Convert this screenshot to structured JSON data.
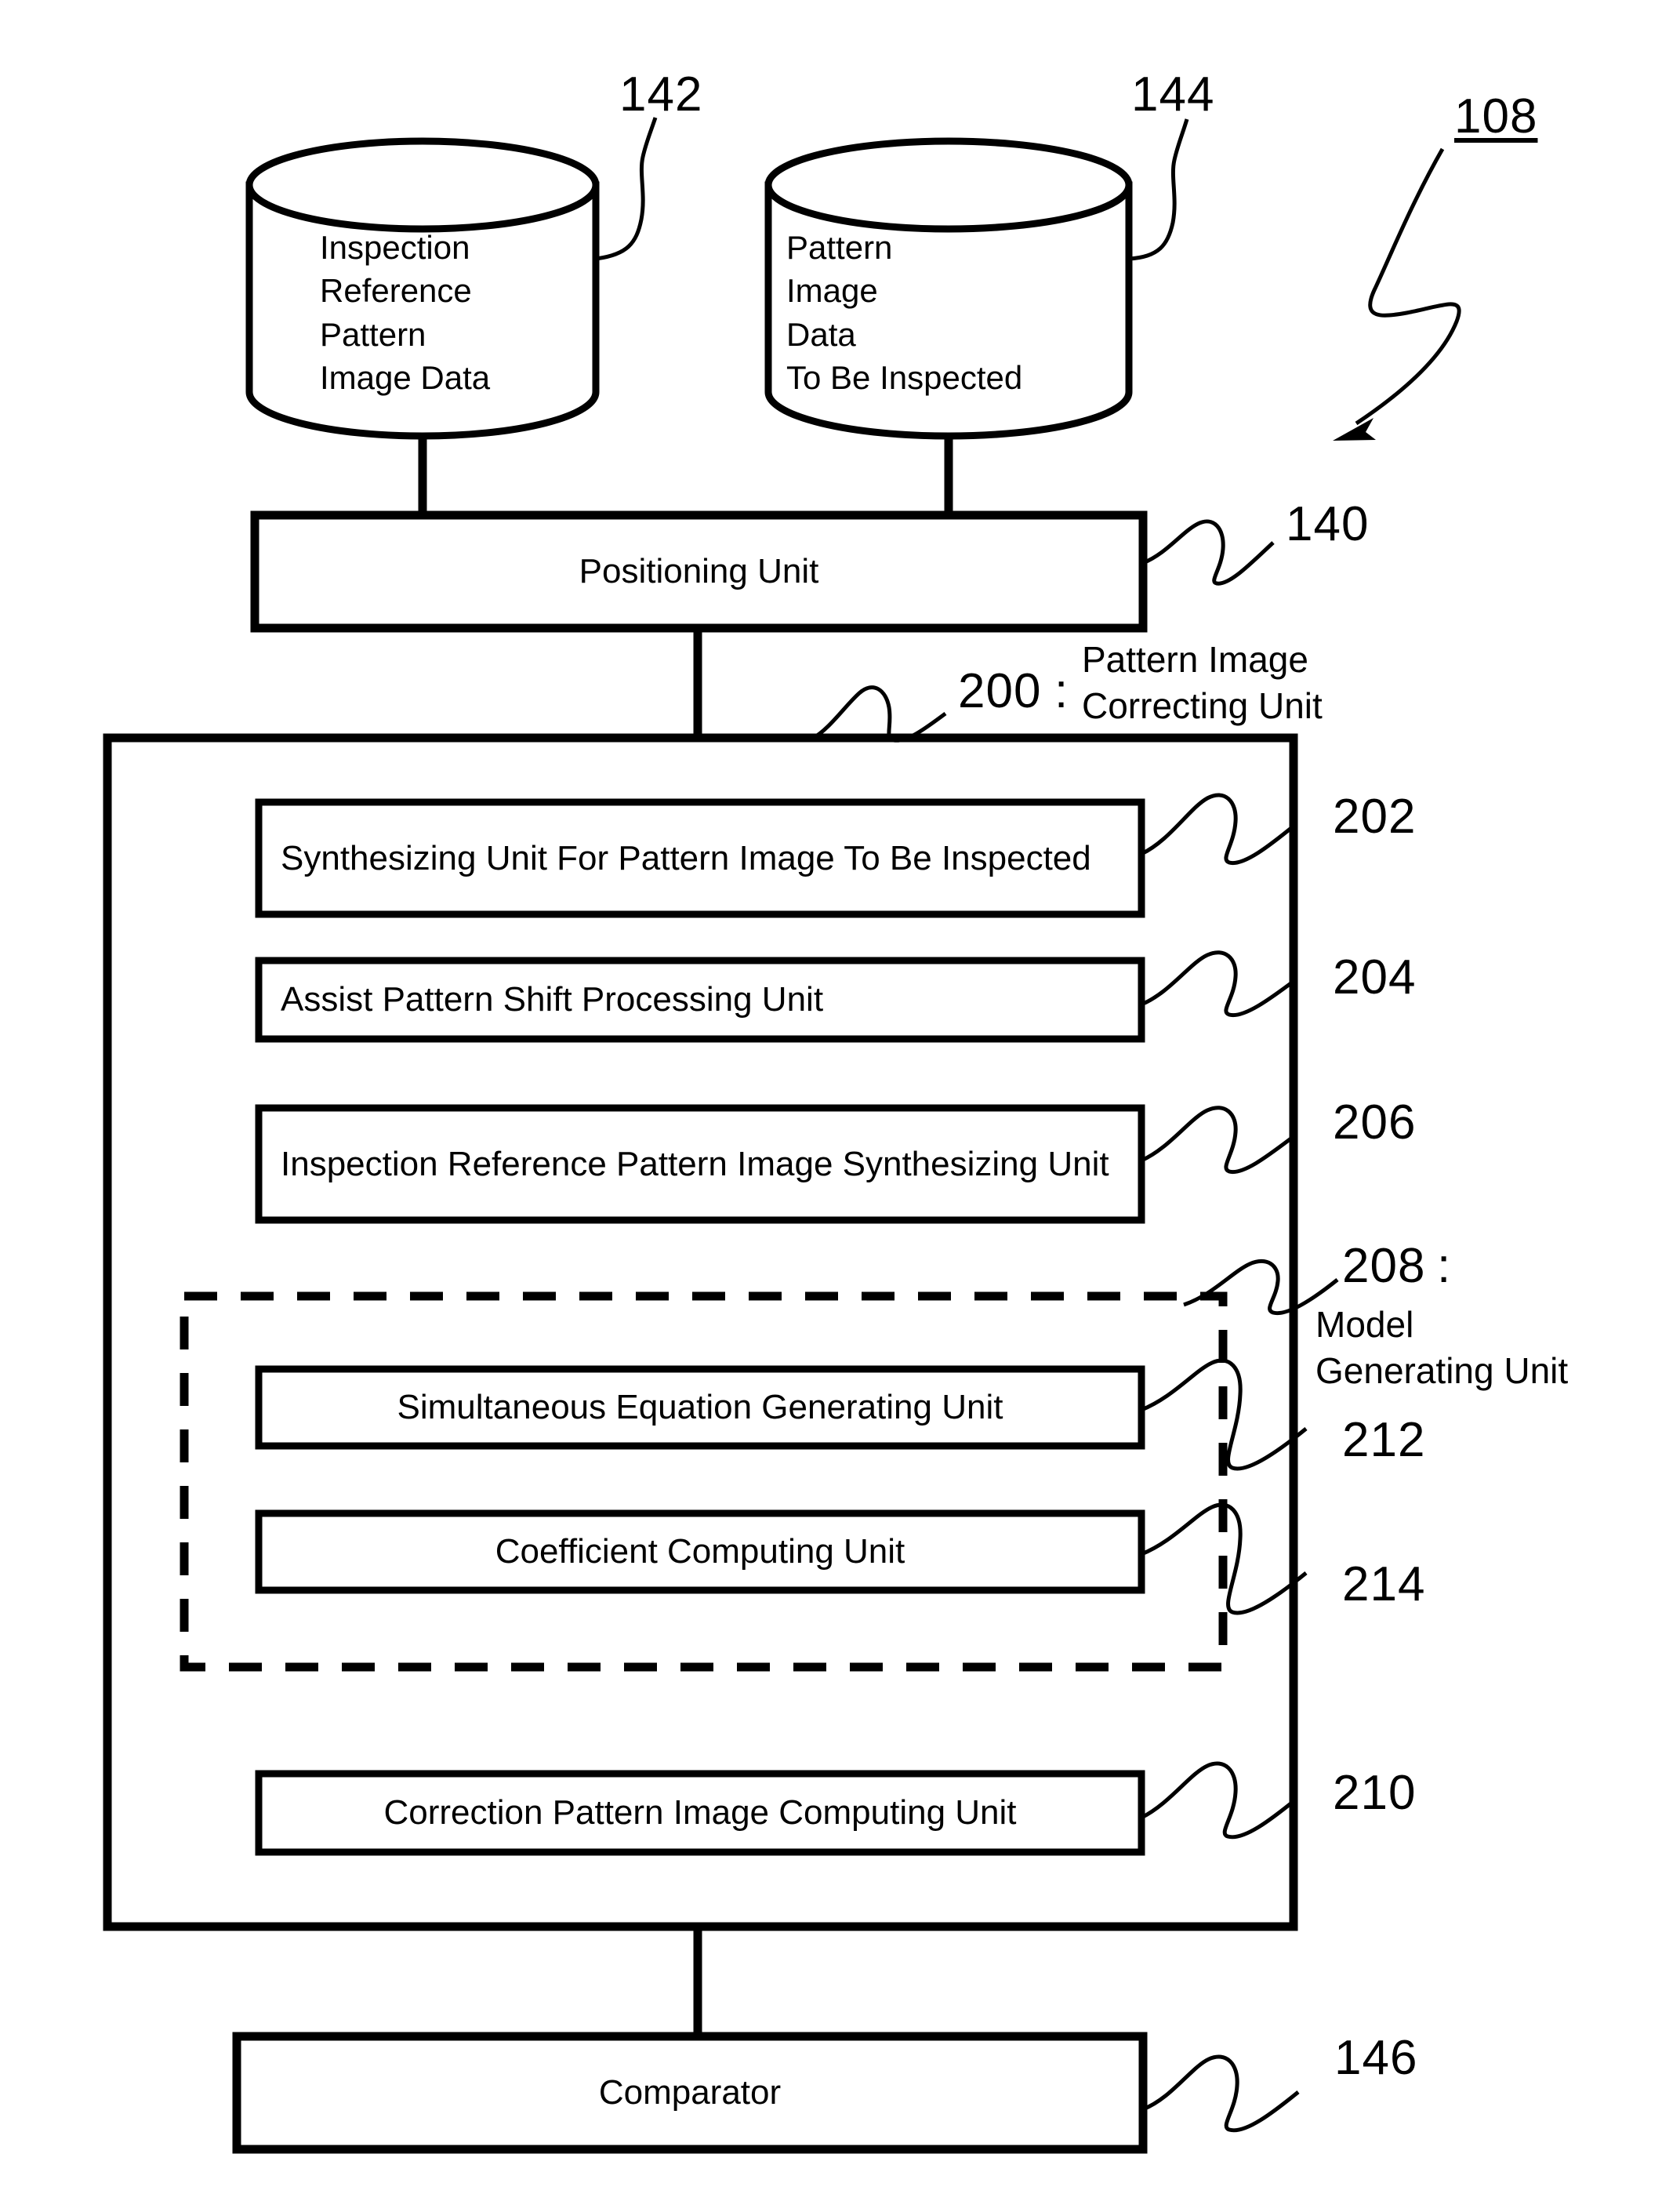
{
  "figure": {
    "overall_ref": "108",
    "databases": [
      {
        "ref": "142",
        "lines": [
          "Inspection",
          "Reference",
          "Pattern",
          "Image Data"
        ],
        "text": "Inspection\nReference\nPattern\nImage Data"
      },
      {
        "ref": "144",
        "lines": [
          "Pattern",
          "Image",
          "Data",
          "To Be Inspected"
        ],
        "text": "Pattern\nImage\nData\nTo Be Inspected"
      }
    ],
    "positioning_unit": {
      "ref": "140",
      "label": "Positioning Unit"
    },
    "correcting_unit": {
      "ref": "200",
      "ref_sep": ":",
      "label": "Pattern Image\nCorrecting Unit",
      "label_line1": "Pattern Image",
      "label_line2": "Correcting Unit"
    },
    "inner_units": [
      {
        "ref": "202",
        "label": "Synthesizing Unit For Pattern Image\nTo Be Inspected",
        "label_line1": "Synthesizing Unit For Pattern Image",
        "label_line2": "To Be Inspected"
      },
      {
        "ref": "204",
        "label": "Assist Pattern Shift Processing Unit"
      },
      {
        "ref": "206",
        "label": "Inspection Reference Pattern Image\nSynthesizing Unit",
        "label_line1": "Inspection Reference Pattern Image",
        "label_line2": "Synthesizing Unit"
      }
    ],
    "model_generating_unit": {
      "ref": "208",
      "ref_sep": ":",
      "label": "Model\nGenerating Unit",
      "label_line1": "Model",
      "label_line2": "Generating Unit",
      "children": [
        {
          "ref": "212",
          "label": "Simultaneous Equation Generating Unit"
        },
        {
          "ref": "214",
          "label": "Coefficient Computing Unit"
        }
      ]
    },
    "correction_computing_unit": {
      "ref": "210",
      "label": "Correction Pattern Image Computing Unit"
    },
    "comparator": {
      "ref": "146",
      "label": "Comparator"
    },
    "colors": {
      "ink": "#000000",
      "paper": "#ffffff"
    }
  }
}
